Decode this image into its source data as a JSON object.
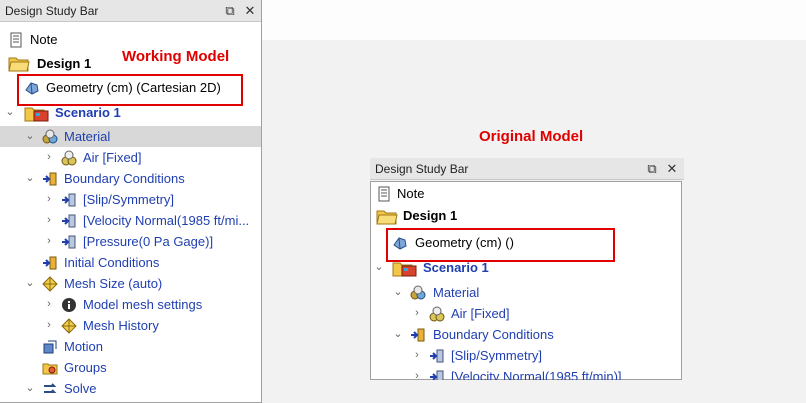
{
  "left_panel": {
    "title": "Design Study Bar",
    "items": {
      "note": "Note",
      "design": "Design 1",
      "geometry": "Geometry (cm) (Cartesian 2D)",
      "scenario": "Scenario 1",
      "material": "Material",
      "air": "Air [Fixed]",
      "boundary_conditions": "Boundary Conditions",
      "slip": "[Slip/Symmetry]",
      "velocity": "[Velocity Normal(1985 ft/mi...",
      "pressure": "[Pressure(0 Pa Gage)]",
      "initial_conditions": "Initial Conditions",
      "mesh_size": "Mesh Size (auto)",
      "model_mesh_settings": "Model mesh settings",
      "mesh_history": "Mesh History",
      "motion": "Motion",
      "groups": "Groups",
      "solve": "Solve"
    }
  },
  "right_panel": {
    "title": "Design Study Bar",
    "items": {
      "note": "Note",
      "design": "Design 1",
      "geometry": "Geometry (cm) ()",
      "scenario": "Scenario 1",
      "material": "Material",
      "air": "Air [Fixed]",
      "boundary_conditions": "Boundary Conditions",
      "slip": "[Slip/Symmetry]",
      "velocity": "[Velocity Normal(1985 ft/min)]"
    }
  },
  "annotations": {
    "working_model": "Working Model",
    "original_model": "Original Model"
  },
  "colors": {
    "annotation_red": "#e00000",
    "link_blue": "#1f3fb0",
    "selection_gray": "#d8d8d8"
  },
  "icons": [
    "note-icon",
    "folder-icon",
    "geometry-icon",
    "scenario-icon",
    "material-icon",
    "air-icon",
    "boundary-icon",
    "mesh-icon",
    "info-icon",
    "motion-icon",
    "groups-icon",
    "solve-icon",
    "restore-icon",
    "close-icon"
  ]
}
